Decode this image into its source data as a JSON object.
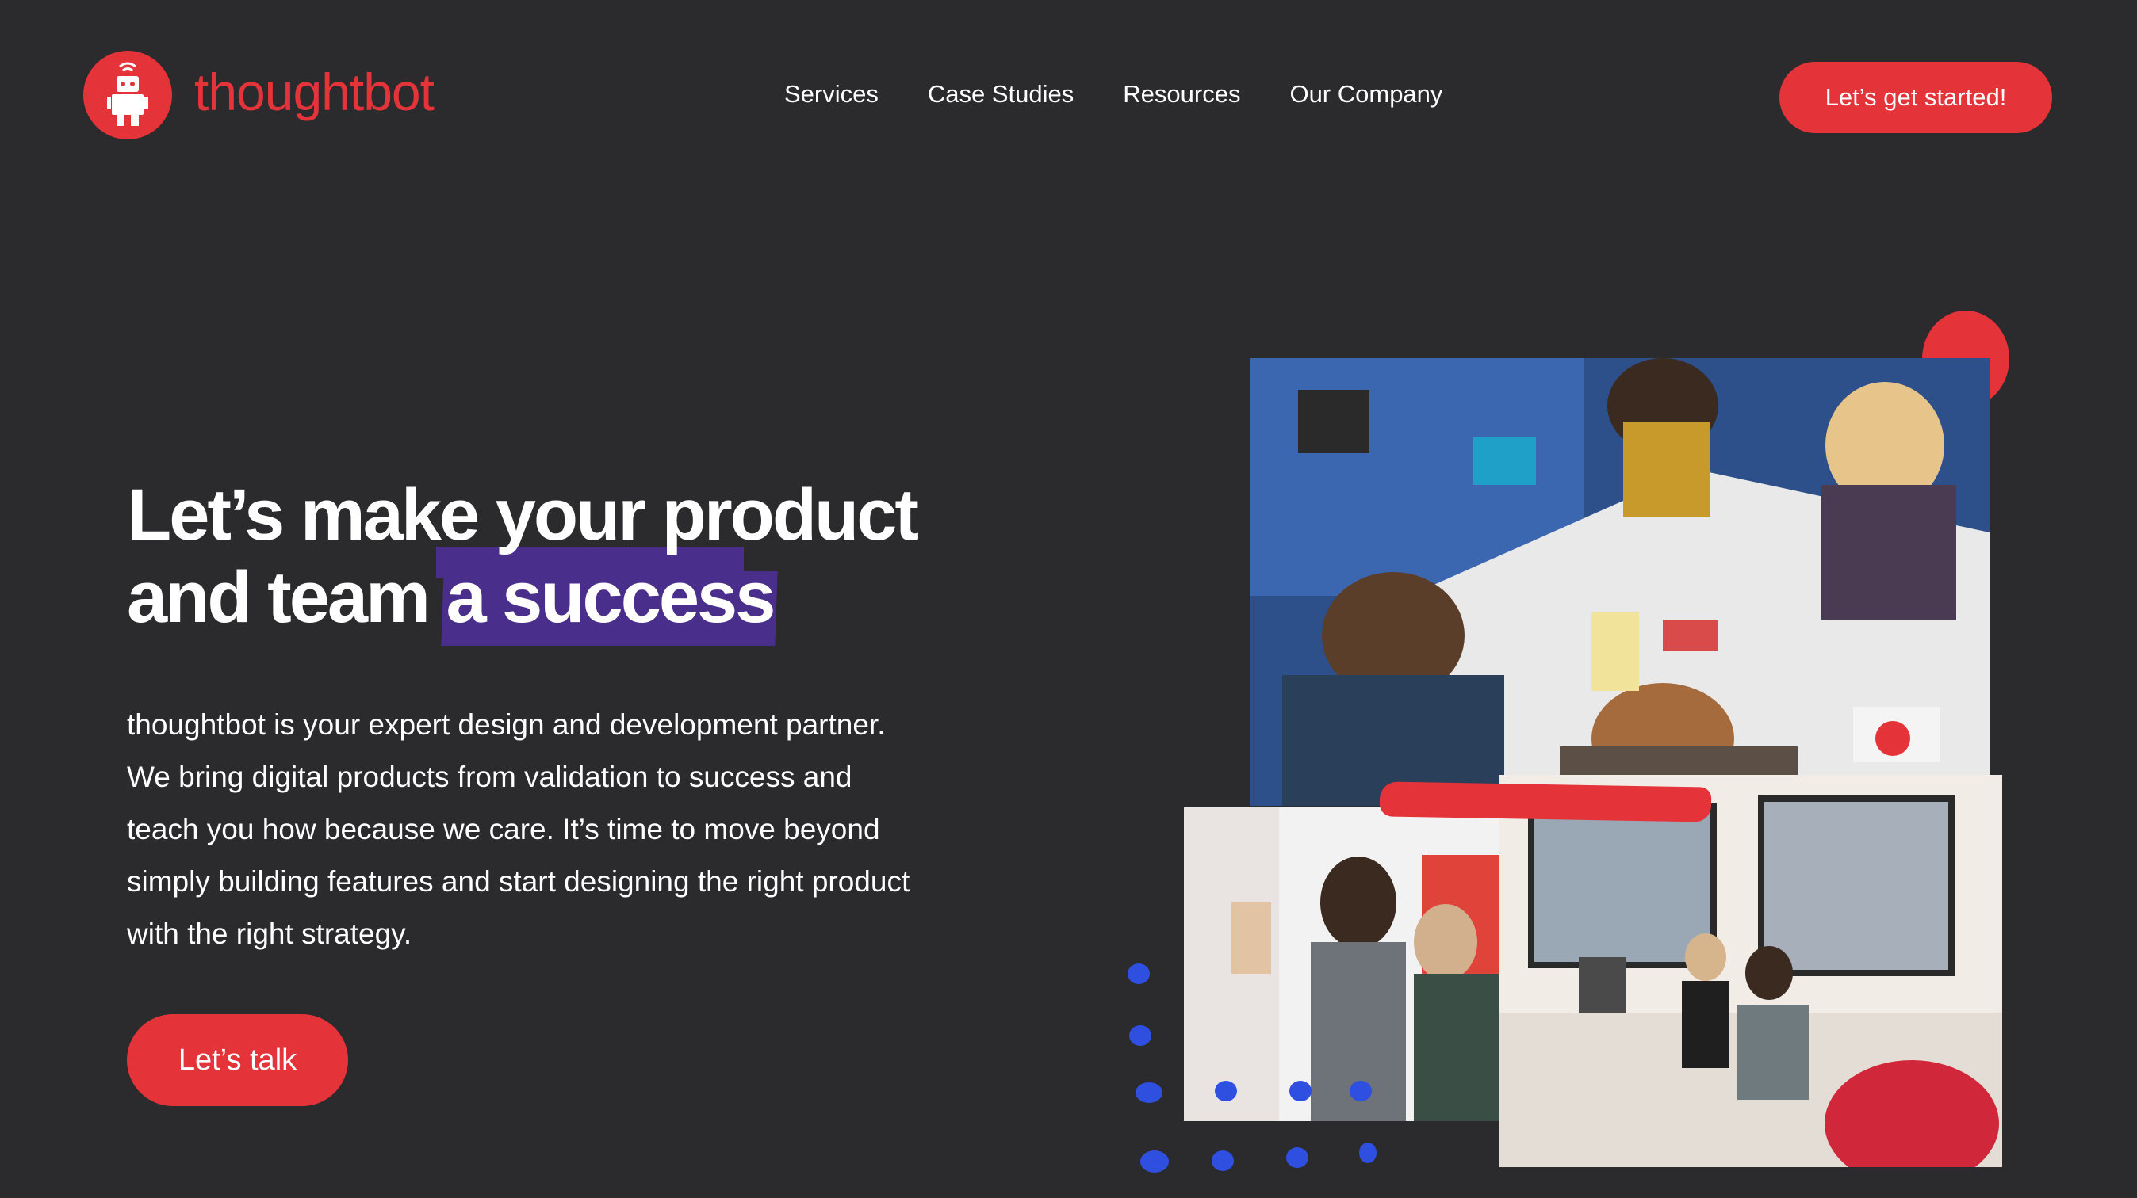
{
  "brand": {
    "name": "thoughtbot",
    "accent_color": "#e5333a",
    "highlight_color": "#4a2e8c",
    "dot_color": "#2f4fe0",
    "background": "#2b2b2e"
  },
  "nav": {
    "items": [
      {
        "label": "Services"
      },
      {
        "label": "Case Studies"
      },
      {
        "label": "Resources"
      },
      {
        "label": "Our Company"
      }
    ],
    "cta_label": "Let’s get started!"
  },
  "hero": {
    "headline_line1": "Let’s make your product",
    "headline_line2_plain": "and team ",
    "headline_line2_highlight": "a success",
    "body": "thoughtbot is your expert design and development partner. We bring digital products from validation to success and teach you how because we care. It’s time to move beyond simply building features and start designing the right product with the right strategy.",
    "cta_label": "Let’s talk"
  },
  "collage": {
    "images": [
      {
        "name": "team-workshop-photo",
        "description_icon": "photo-icon"
      },
      {
        "name": "whiteboard-photo",
        "description_icon": "photo-icon"
      },
      {
        "name": "office-desks-photo",
        "description_icon": "photo-icon"
      }
    ]
  }
}
